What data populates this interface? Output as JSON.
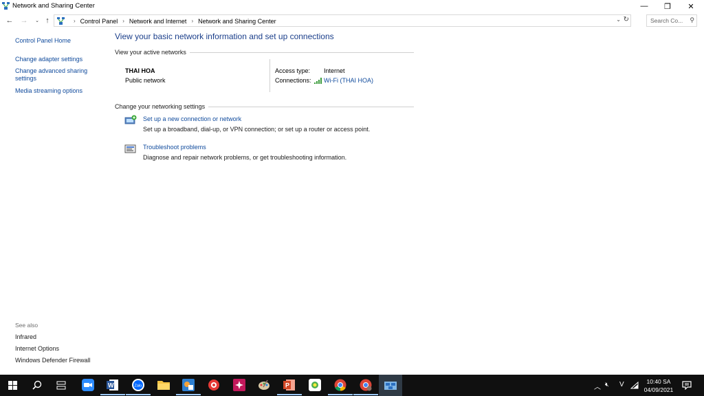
{
  "window": {
    "title": "Network and Sharing Center",
    "controls": {
      "minimize": "—",
      "restore": "❐",
      "close": "✕"
    }
  },
  "address": {
    "crumbs": [
      "Control Panel",
      "Network and Internet",
      "Network and Sharing Center"
    ],
    "search_placeholder": "Search Co..."
  },
  "left_pane": {
    "home": "Control Panel Home",
    "links": [
      "Change adapter settings",
      "Change advanced sharing settings",
      "Media streaming options"
    ],
    "see_also_label": "See also",
    "see_also": [
      "Infrared",
      "Internet Options",
      "Windows Defender Firewall"
    ]
  },
  "main": {
    "heading": "View your basic network information and set up connections",
    "active_networks_title": "View your active networks",
    "network": {
      "name": "THAI HOA",
      "type": "Public network",
      "access_type_label": "Access type:",
      "access_type": "Internet",
      "connections_label": "Connections:",
      "connection": "Wi-Fi (THAI HOA)"
    },
    "change_title": "Change your networking settings",
    "tasks": [
      {
        "title": "Set up a new connection or network",
        "desc": "Set up a broadband, dial-up, or VPN connection; or set up a router or access point.",
        "icon": "network-setup-icon"
      },
      {
        "title": "Troubleshoot problems",
        "desc": "Diagnose and repair network problems, or get troubleshooting information.",
        "icon": "troubleshoot-icon"
      }
    ]
  },
  "taskbar": {
    "time": "10:40 SA",
    "date": "04/09/2021",
    "ime": "V",
    "icons": [
      "start-icon",
      "search-icon",
      "task-view-icon",
      "zoom-icon",
      "word-icon",
      "zalo-icon",
      "file-explorer-icon",
      "snipping-icon",
      "app-icon",
      "app-icon-2",
      "paint-icon",
      "powerpoint-icon",
      "app-icon-3",
      "chrome-icon",
      "chrome-user-icon",
      "network-center-icon"
    ]
  }
}
